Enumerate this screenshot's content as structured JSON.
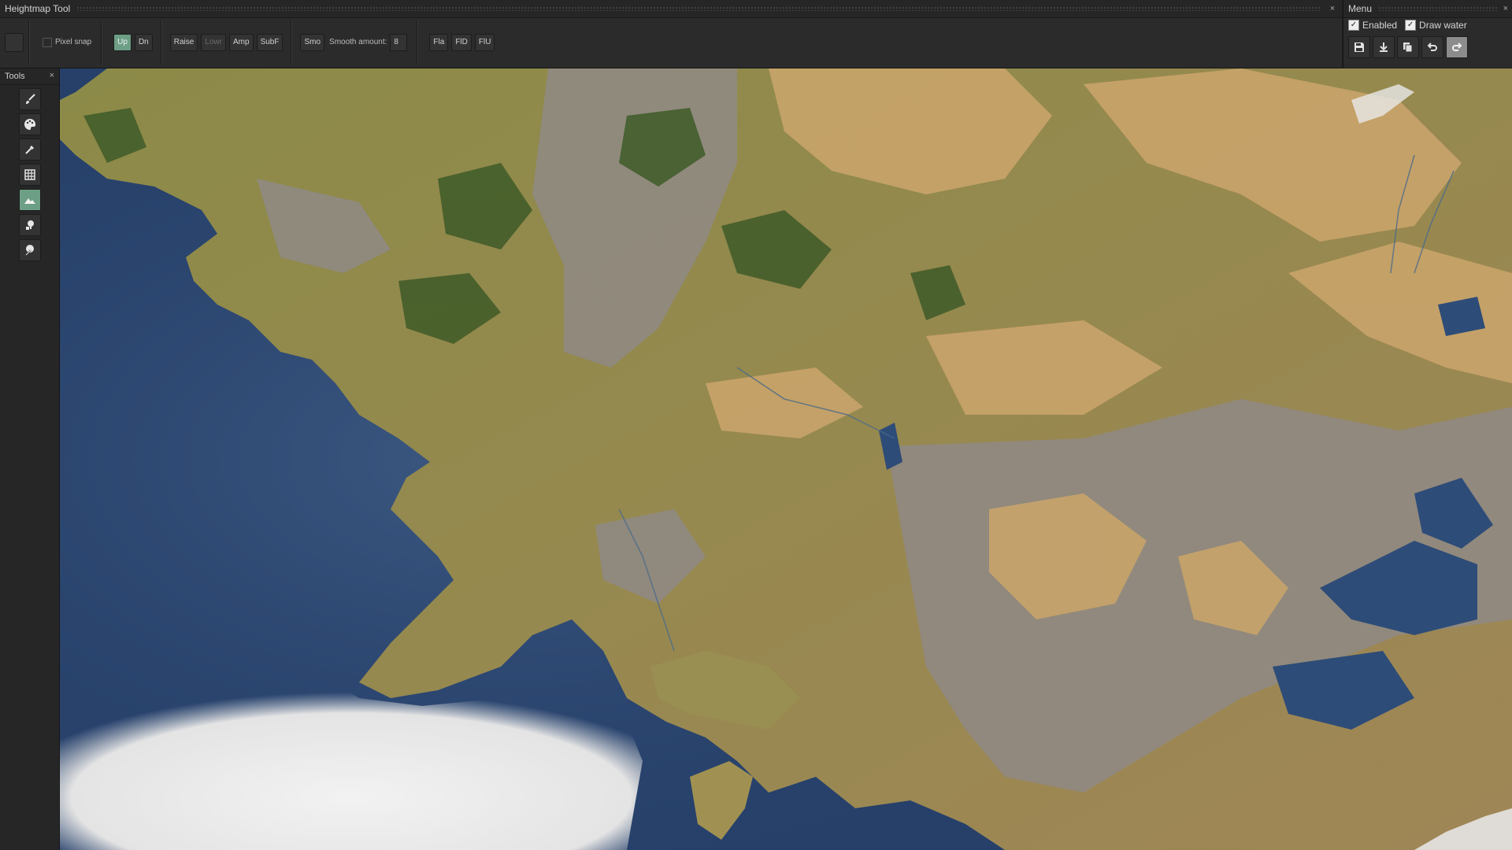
{
  "heightmap_panel": {
    "title": "Heightmap Tool",
    "close": "×",
    "pixel_snap_label": "Pixel snap",
    "up_label": "Up",
    "dn_label": "Dn",
    "raise_label": "Raise",
    "lower_label": "Lowr",
    "amp_label": "Amp",
    "subf_label": "SubF",
    "smo_label": "Smo",
    "smooth_amount_label": "Smooth amount:",
    "smooth_amount_value": "8",
    "fla_label": "Fla",
    "fld_label": "FlD",
    "flu_label": "FlU"
  },
  "menu_panel": {
    "title": "Menu",
    "close": "×",
    "enabled_label": "Enabled",
    "enabled_checked": true,
    "draw_water_label": "Draw water",
    "draw_water_checked": true,
    "icons": [
      "save-icon",
      "download-icon",
      "copy-icon",
      "undo-icon",
      "redo-icon"
    ]
  },
  "tools_panel": {
    "title": "Tools",
    "close": "×",
    "tools": [
      "brush-icon",
      "palette-icon",
      "eyedropper-icon",
      "grid-icon",
      "mountain-icon",
      "tree-stamp-icon",
      "tree-paint-icon"
    ],
    "active_tool": "mountain-icon"
  },
  "colors": {
    "active_accent": "#6d9f86",
    "panel_bg": "#2b2b2b",
    "water": "#26406a",
    "grass": "#8a8a45",
    "sand": "#c9a46a",
    "rock": "#8f8a85",
    "forest": "#3e5a28",
    "cloud": "#e8e8e8"
  }
}
